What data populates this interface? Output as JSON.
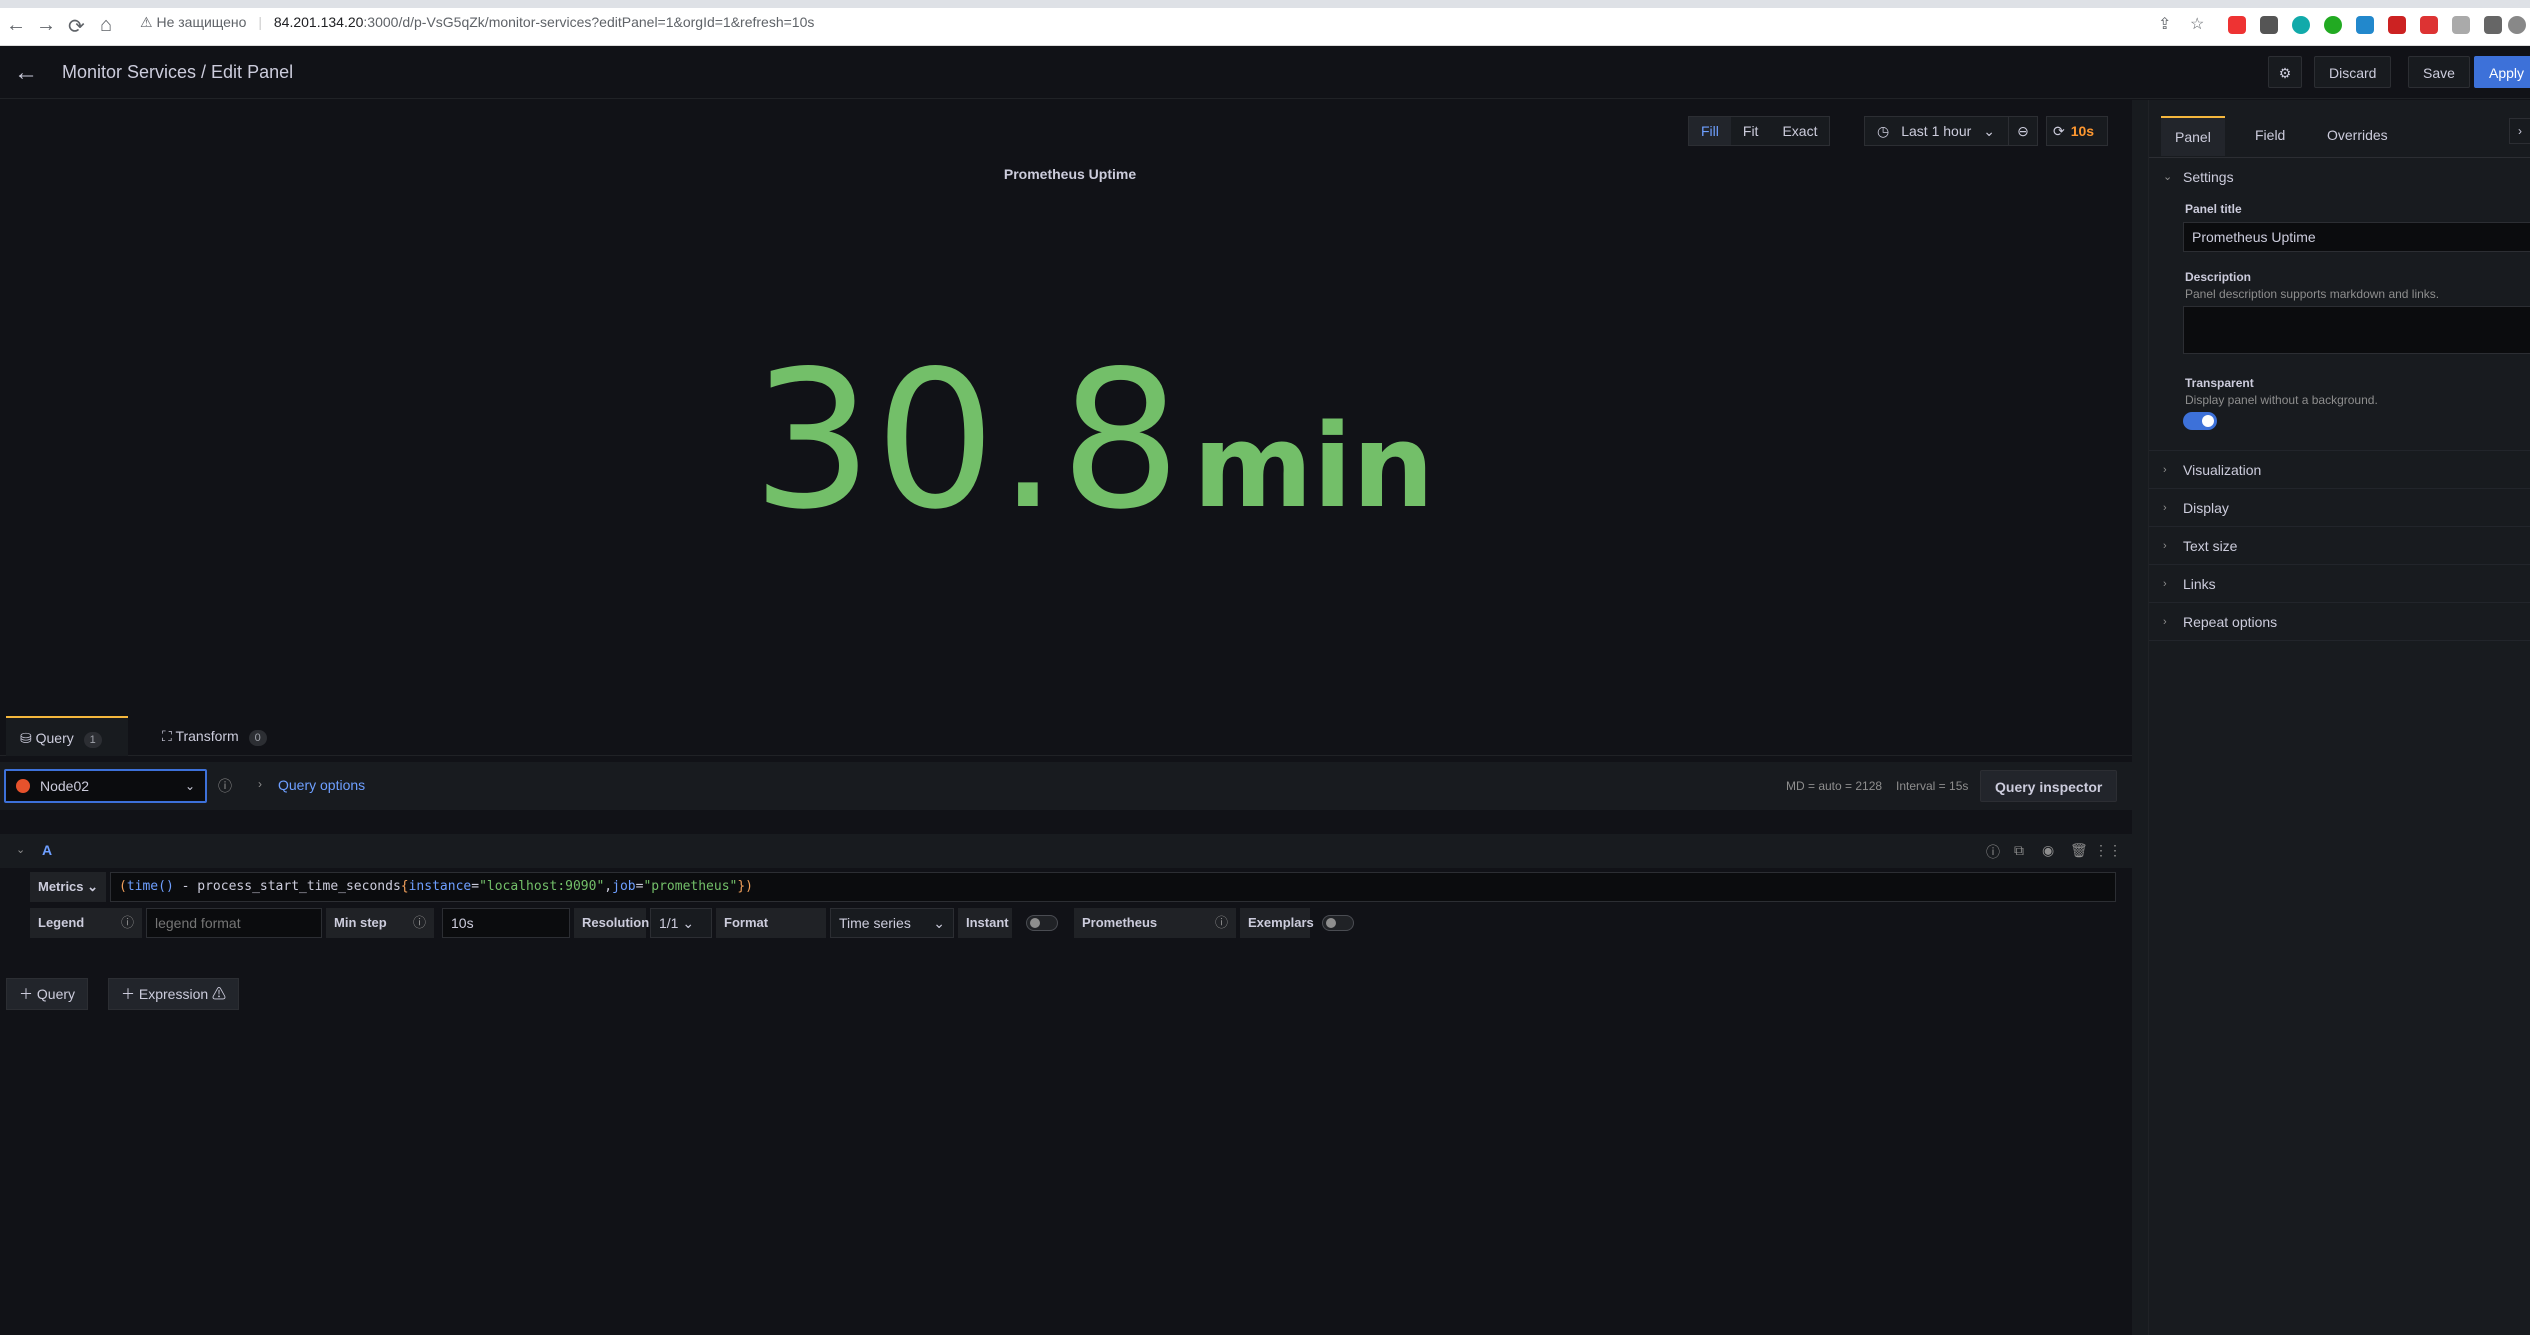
{
  "browser": {
    "security_text": "Не защищено",
    "url_host": "84.201.134.20",
    "url_path": ":3000/d/p-VsG5qZk/monitor-services?editPanel=1&orgId=1&refresh=10s"
  },
  "header": {
    "title": "Monitor Services / Edit Panel",
    "discard": "Discard",
    "save": "Save",
    "apply": "Apply"
  },
  "panel_toolbar": {
    "fill": "Fill",
    "fit": "Fit",
    "exact": "Exact",
    "time_range": "Last 1 hour",
    "refresh": "10s"
  },
  "panel": {
    "title": "Prometheus Uptime",
    "value": "30.8",
    "unit": "min",
    "value_color": "#73bf69"
  },
  "query_tabs": {
    "query_label": "Query",
    "query_count": "1",
    "transform_label": "Transform",
    "transform_count": "0"
  },
  "datasource": {
    "name": "Node02",
    "query_options": "Query options",
    "md": "MD = auto = 2128",
    "interval": "Interval = 15s",
    "inspector": "Query inspector"
  },
  "query": {
    "ref": "A",
    "metrics_label": "Metrics",
    "expr_open": "(",
    "expr_fn": "time()",
    "expr_op": " - process_start_time_seconds",
    "expr_brace_open": "{",
    "expr_k1": "instance",
    "expr_eq1": "=",
    "expr_v1": "\"localhost:9090\"",
    "expr_comma": ",",
    "expr_k2": "job",
    "expr_eq2": "=",
    "expr_v2": "\"prometheus\"",
    "expr_close": "})",
    "legend_label": "Legend",
    "legend_placeholder": "legend format",
    "minstep_label": "Min step",
    "minstep_value": "10s",
    "resolution_label": "Resolution",
    "resolution_value": "1/1",
    "format_label": "Format",
    "format_value": "Time series",
    "instant_label": "Instant",
    "prometheus_label": "Prometheus",
    "exemplars_label": "Exemplars"
  },
  "add": {
    "query": "Query",
    "expression": "Expression"
  },
  "sidebar": {
    "tabs": [
      "Panel",
      "Field",
      "Overrides"
    ],
    "settings": "Settings",
    "panel_title_label": "Panel title",
    "panel_title_value": "Prometheus Uptime",
    "description_label": "Description",
    "description_hint": "Panel description supports markdown and links.",
    "transparent_label": "Transparent",
    "transparent_hint": "Display panel without a background.",
    "sections": [
      "Visualization",
      "Display",
      "Text size",
      "Links",
      "Repeat options"
    ]
  }
}
